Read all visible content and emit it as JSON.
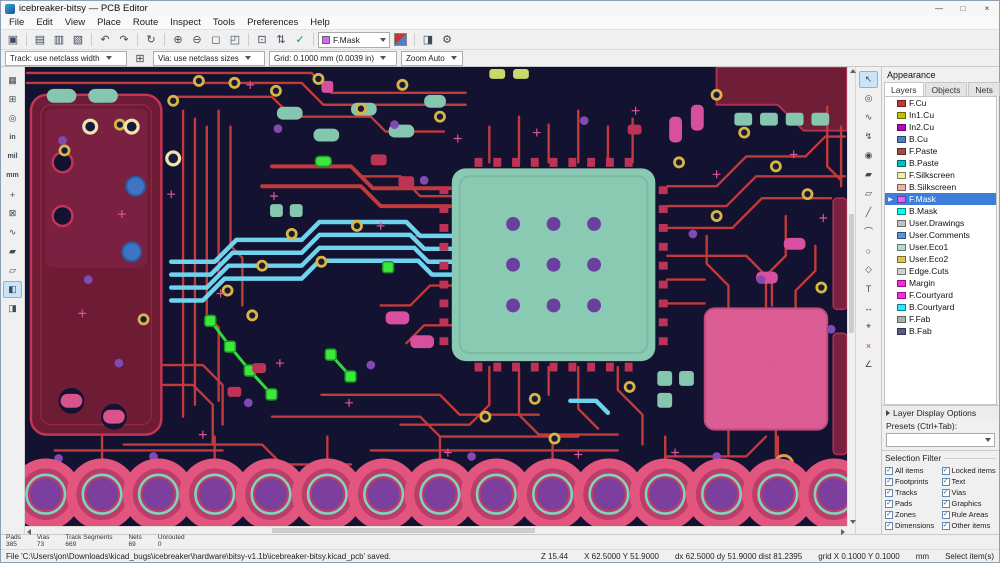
{
  "window": {
    "title": "icebreaker-bitsy — PCB Editor",
    "controls": {
      "minimize": "—",
      "maximize": "□",
      "close": "×"
    }
  },
  "menubar": {
    "items": [
      "File",
      "Edit",
      "View",
      "Place",
      "Route",
      "Inspect",
      "Tools",
      "Preferences",
      "Help"
    ]
  },
  "toolbar": {
    "buttons": [
      {
        "name": "save",
        "glyph": "▣"
      },
      {
        "name": "page-settings",
        "glyph": "▤"
      },
      {
        "name": "print",
        "glyph": "▥"
      },
      {
        "name": "plot",
        "glyph": "▧"
      },
      {
        "name": "undo",
        "glyph": "↶"
      },
      {
        "name": "redo",
        "glyph": "↷"
      },
      {
        "name": "refresh",
        "glyph": "↻"
      },
      {
        "name": "zoom-in",
        "glyph": "⊕"
      },
      {
        "name": "zoom-out",
        "glyph": "⊖"
      },
      {
        "name": "zoom-fit",
        "glyph": "◻"
      },
      {
        "name": "zoom-selection",
        "glyph": "◰"
      },
      {
        "name": "footprint-editor",
        "glyph": "⊡"
      },
      {
        "name": "update-pcb",
        "glyph": "⇅"
      },
      {
        "name": "drc-check",
        "glyph": "✓"
      }
    ],
    "active_layer": "F.Mask",
    "post_buttons": [
      {
        "name": "high-contrast",
        "glyph": "◨"
      },
      {
        "name": "settings",
        "glyph": "⚙"
      }
    ]
  },
  "toolbar2": {
    "track": "Track: use netclass width",
    "edit_sizes_glyph": "⊞",
    "via": "Via: use netclass sizes",
    "grid": "Grid: 0.1000 mm (0.0039 in)",
    "zoom": "Zoom Auto"
  },
  "left_toolbar": {
    "items": [
      {
        "name": "show-grid",
        "glyph": "▦"
      },
      {
        "name": "grid-origin",
        "glyph": "⊞"
      },
      {
        "name": "polar-coordinates",
        "glyph": "◎"
      },
      {
        "name": "units-inches",
        "glyph": "in"
      },
      {
        "name": "units-mils",
        "glyph": "mil"
      },
      {
        "name": "units-mm",
        "glyph": "mm"
      },
      {
        "name": "crosshair-cursor",
        "glyph": "+"
      },
      {
        "name": "show-ratsnest",
        "glyph": "⊠"
      },
      {
        "name": "curved-ratsnest",
        "glyph": "∿"
      },
      {
        "name": "zone-fill-mode",
        "glyph": "▰"
      },
      {
        "name": "zone-outline-mode",
        "glyph": "▱"
      },
      {
        "name": "dim-inactive-layers",
        "glyph": "◧"
      },
      {
        "name": "high-contrast-mode",
        "glyph": "◨"
      }
    ]
  },
  "right_toolbar": {
    "items": [
      {
        "name": "select-tool",
        "glyph": "↖"
      },
      {
        "name": "highlight-net-tool",
        "glyph": "◎"
      },
      {
        "name": "local-ratsnest-tool",
        "glyph": "∿"
      },
      {
        "name": "route-track-tool",
        "glyph": "↯"
      },
      {
        "name": "via-tool",
        "glyph": "◉"
      },
      {
        "name": "zone-tool",
        "glyph": "▰"
      },
      {
        "name": "rule-area-tool",
        "glyph": "▱"
      },
      {
        "name": "line-tool",
        "glyph": "╱"
      },
      {
        "name": "arc-tool",
        "glyph": "⌒"
      },
      {
        "name": "circle-tool",
        "glyph": "○"
      },
      {
        "name": "polygon-tool",
        "glyph": "◇"
      },
      {
        "name": "text-tool",
        "glyph": "T"
      },
      {
        "name": "dimension-tool",
        "glyph": "↔"
      },
      {
        "name": "origin-tool",
        "glyph": "⌖"
      },
      {
        "name": "delete-tool",
        "glyph": "×"
      },
      {
        "name": "measure-tool",
        "glyph": "∠"
      }
    ]
  },
  "appearance": {
    "title": "Appearance",
    "tabs": [
      "Layers",
      "Objects",
      "Nets"
    ],
    "layers": [
      {
        "name": "F.Cu",
        "color": "#C83434"
      },
      {
        "name": "In1.Cu",
        "color": "#C2C200"
      },
      {
        "name": "In2.Cu",
        "color": "#C200C2"
      },
      {
        "name": "B.Cu",
        "color": "#4D7FC4"
      },
      {
        "name": "F.Paste",
        "color": "#A54B42"
      },
      {
        "name": "B.Paste",
        "color": "#00C2C2"
      },
      {
        "name": "F.Silkscreen",
        "color": "#F2EDA1"
      },
      {
        "name": "B.Silkscreen",
        "color": "#E8B2A7"
      },
      {
        "name": "F.Mask",
        "color": "#D864FF"
      },
      {
        "name": "B.Mask",
        "color": "#02FFEE"
      },
      {
        "name": "User.Drawings",
        "color": "#C2C2C2"
      },
      {
        "name": "User.Comments",
        "color": "#5994DC"
      },
      {
        "name": "User.Eco1",
        "color": "#B4DBD2"
      },
      {
        "name": "User.Eco2",
        "color": "#D8C852"
      },
      {
        "name": "Edge.Cuts",
        "color": "#D0D2CD"
      },
      {
        "name": "Margin",
        "color": "#FF26E2"
      },
      {
        "name": "F.Courtyard",
        "color": "#FF26E2"
      },
      {
        "name": "B.Courtyard",
        "color": "#26E9FF"
      },
      {
        "name": "F.Fab",
        "color": "#AFAFAF"
      },
      {
        "name": "B.Fab",
        "color": "#585D84"
      }
    ],
    "display_options_label": "Layer Display Options",
    "presets_label": "Presets (Ctrl+Tab):",
    "presets_value": "",
    "selection_filter": {
      "title": "Selection Filter",
      "items_col1": [
        "All items",
        "Footprints",
        "Tracks",
        "Pads",
        "Zones",
        "Dimensions"
      ],
      "items_col2": [
        "Locked items",
        "Text",
        "Vias",
        "Graphics",
        "Rule Areas",
        "Other items"
      ]
    }
  },
  "status": {
    "stats": [
      {
        "label": "Pads",
        "value": "385"
      },
      {
        "label": "Vias",
        "value": "73"
      },
      {
        "label": "Track Segments",
        "value": "669"
      },
      {
        "label": "Nets",
        "value": "69"
      },
      {
        "label": "Unrouted",
        "value": "0"
      }
    ],
    "message": "File 'C:\\Users\\jon\\Downloads\\kicad_bugs\\icebreaker\\hardware\\bitsy-v1.1b\\icebreaker-bitsy.kicad_pcb' saved.",
    "zoom": "Z 15.44",
    "cursor": "X 62.5000  Y 51.9000",
    "delta": "dx 62.5000  dy 51.9000  dist 81.2395",
    "grid": "grid X 0.1000  Y 0.1000",
    "units": "mm",
    "hint": "Select item(s)"
  }
}
